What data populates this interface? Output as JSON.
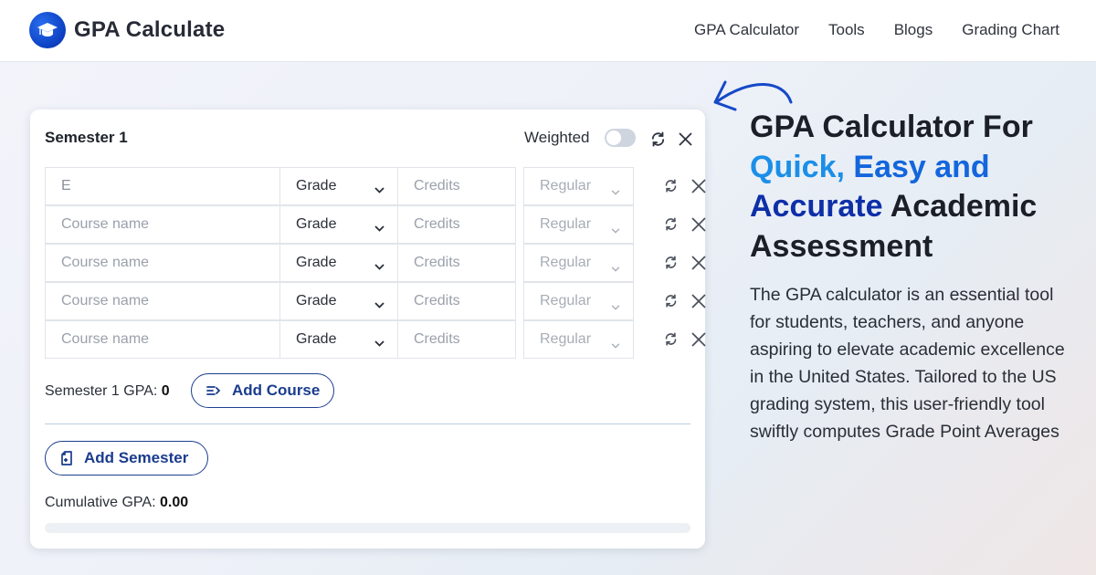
{
  "header": {
    "brand": "GPA Calculate",
    "logo_icon": "graduation-cap-icon",
    "nav": [
      {
        "label": "GPA Calculator"
      },
      {
        "label": "Tools"
      },
      {
        "label": "Blogs"
      },
      {
        "label": "Grading Chart"
      }
    ]
  },
  "semester": {
    "title": "Semester 1",
    "weighted_label": "Weighted",
    "weighted_on": false,
    "courses": [
      {
        "name_value": "E",
        "name_placeholder": "Course name",
        "grade": "Grade",
        "credits_placeholder": "Credits",
        "type": "Regular"
      },
      {
        "name_value": "",
        "name_placeholder": "Course name",
        "grade": "Grade",
        "credits_placeholder": "Credits",
        "type": "Regular"
      },
      {
        "name_value": "",
        "name_placeholder": "Course name",
        "grade": "Grade",
        "credits_placeholder": "Credits",
        "type": "Regular"
      },
      {
        "name_value": "",
        "name_placeholder": "Course name",
        "grade": "Grade",
        "credits_placeholder": "Credits",
        "type": "Regular"
      },
      {
        "name_value": "",
        "name_placeholder": "Course name",
        "grade": "Grade",
        "credits_placeholder": "Credits",
        "type": "Regular"
      }
    ],
    "gpa_label": "Semester 1 GPA: ",
    "gpa_value": "0",
    "add_course_label": "Add Course"
  },
  "add_semester_label": "Add Semester",
  "cumulative": {
    "label": "Cumulative GPA: ",
    "value": "0.00",
    "progress_fraction": 0
  },
  "hero": {
    "title_line1": "GPA Calculator For",
    "title_quick": "Quick,",
    "title_easy": "Easy and",
    "title_accurate": "Accurate",
    "title_rest1": "Academic",
    "title_rest2": "Assessment",
    "description": "The GPA calculator is an essential tool for students, teachers, and anyone aspiring to elevate academic excellence in the United States. Tailored to the US grading system, this user-friendly tool swiftly computes Grade Point Averages"
  },
  "colors": {
    "brand_blue": "#0b3fc0",
    "button_blue": "#1a3c8e",
    "hero_light_blue": "#1b8fe8",
    "hero_dark_blue": "#0e2fa8"
  }
}
